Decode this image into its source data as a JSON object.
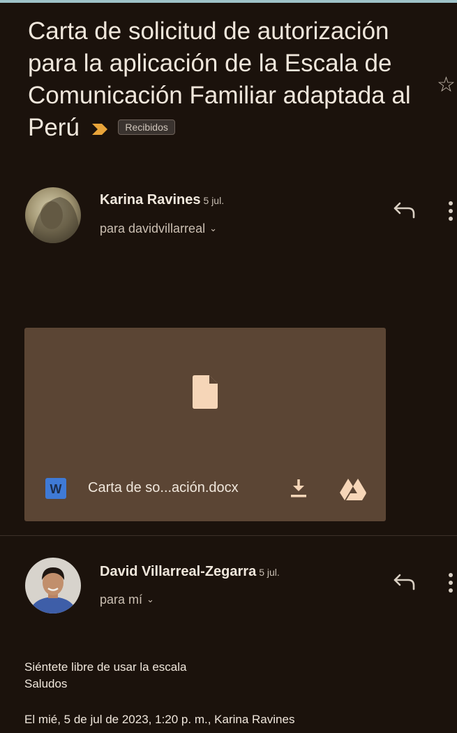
{
  "thread": {
    "subject": "Carta de solicitud de autorización para la aplicación de la Escala de Comunicación Familiar adaptada al Perú",
    "label": "Recibidos",
    "importance_color": "#e8a43a",
    "star_icon": "star-outline-icon"
  },
  "messages": [
    {
      "sender": "Karina Ravines",
      "date": "5 jul.",
      "recipient": "para davidvillarreal",
      "chevron": "⌄",
      "attachment": {
        "file_name": "Carta de so...ación.docx",
        "type_badge": "W",
        "file_icon": "document-icon",
        "download_icon": "download-icon",
        "drive_icon": "google-drive-icon"
      }
    },
    {
      "sender": "David Villarreal-Zegarra",
      "date": "5 jul.",
      "recipient": "para mí",
      "chevron": "⌄",
      "body_lines": [
        "Siéntete libre de usar la escala",
        "Saludos"
      ],
      "quote_intro": "El mié, 5 de jul de 2023, 1:20 p. m., Karina Ravines"
    }
  ]
}
